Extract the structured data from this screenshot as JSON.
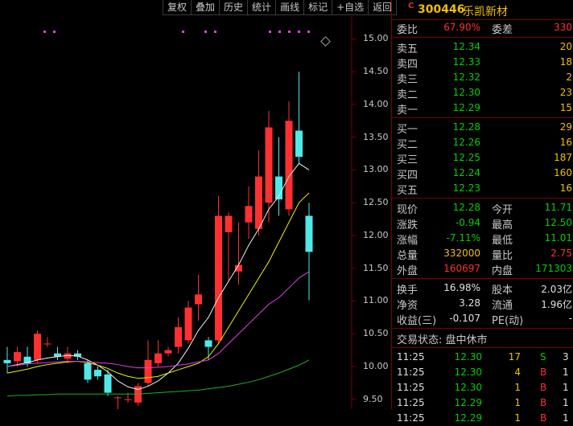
{
  "toolbar": [
    "复权",
    "叠加",
    "历史",
    "统计",
    "画线",
    "标记",
    "+自选",
    "返回"
  ],
  "stock": {
    "marker": "C",
    "code": "300446",
    "name": "乐凯新材"
  },
  "weibi": {
    "label": "委比",
    "value": "67.90%",
    "diff_label": "委差",
    "diff_value": "330"
  },
  "sell": [
    {
      "label": "卖五",
      "price": "12.34",
      "vol": "20"
    },
    {
      "label": "卖四",
      "price": "12.33",
      "vol": "18"
    },
    {
      "label": "卖三",
      "price": "12.32",
      "vol": "2"
    },
    {
      "label": "卖二",
      "price": "12.30",
      "vol": "23"
    },
    {
      "label": "卖一",
      "price": "12.29",
      "vol": "15"
    }
  ],
  "buy": [
    {
      "label": "买一",
      "price": "12.28",
      "vol": "29"
    },
    {
      "label": "买二",
      "price": "12.26",
      "vol": "16"
    },
    {
      "label": "买三",
      "price": "12.25",
      "vol": "187"
    },
    {
      "label": "买四",
      "price": "12.24",
      "vol": "160"
    },
    {
      "label": "买五",
      "price": "12.23",
      "vol": "16"
    }
  ],
  "quote": [
    {
      "l1": "现价",
      "v1": "12.28",
      "c1": "green",
      "l2": "今开",
      "v2": "11.71",
      "c2": "green"
    },
    {
      "l1": "涨跌",
      "v1": "-0.94",
      "c1": "green",
      "l2": "最高",
      "v2": "12.50",
      "c2": "green"
    },
    {
      "l1": "涨幅",
      "v1": "-7.11%",
      "c1": "green",
      "l2": "最低",
      "v2": "11.01",
      "c2": "green"
    },
    {
      "l1": "总量",
      "v1": "332000",
      "c1": "yellow",
      "l2": "量比",
      "v2": "2.75",
      "c2": "red"
    },
    {
      "l1": "外盘",
      "v1": "160697",
      "c1": "red",
      "l2": "内盘",
      "v2": "171303",
      "c2": "green"
    }
  ],
  "fund": [
    {
      "l1": "换手",
      "v1": "16.98%",
      "l2": "股本",
      "v2": "2.03亿"
    },
    {
      "l1": "净资",
      "v1": "3.28",
      "l2": "流通",
      "v2": "1.96亿"
    },
    {
      "l1": "收益(三)",
      "v1": "-0.107",
      "l2": "PE(动)",
      "v2": "-"
    }
  ],
  "trade_status": "交易状态: 盘中休市",
  "ticks": [
    {
      "time": "11:25",
      "price": "12.30",
      "vol": "17",
      "side": "S",
      "extra": "3"
    },
    {
      "time": "11:25",
      "price": "12.30",
      "vol": "4",
      "side": "B",
      "extra": "1"
    },
    {
      "time": "11:25",
      "price": "12.30",
      "vol": "1",
      "side": "B",
      "extra": "1"
    },
    {
      "time": "11:25",
      "price": "12.29",
      "vol": "1",
      "side": "B",
      "extra": "1"
    },
    {
      "time": "11:25",
      "price": "12.29",
      "vol": "1",
      "side": "B",
      "extra": "1"
    }
  ],
  "chart_data": {
    "type": "candlestick",
    "y_ticks": [
      "15.00",
      "14.50",
      "14.00",
      "13.50",
      "13.00",
      "12.50",
      "12.00",
      "11.50",
      "11.00",
      "10.50",
      "10.00",
      "9.50"
    ],
    "ylim": [
      9.35,
      15.25
    ],
    "candles": [
      {
        "o": 10.1,
        "c": 10.05,
        "h": 10.3,
        "l": 9.9
      },
      {
        "o": 10.08,
        "c": 10.22,
        "h": 10.3,
        "l": 10.0
      },
      {
        "o": 10.15,
        "c": 10.05,
        "h": 10.3,
        "l": 10.0
      },
      {
        "o": 10.1,
        "c": 10.5,
        "h": 10.55,
        "l": 10.05
      },
      {
        "o": 10.35,
        "c": 10.35,
        "h": 10.45,
        "l": 10.3
      },
      {
        "o": 10.2,
        "c": 10.15,
        "h": 10.3,
        "l": 10.1
      },
      {
        "o": 10.12,
        "c": 10.2,
        "h": 10.3,
        "l": 10.05
      },
      {
        "o": 10.2,
        "c": 10.15,
        "h": 10.25,
        "l": 10.1
      },
      {
        "o": 10.05,
        "c": 9.8,
        "h": 10.1,
        "l": 9.75
      },
      {
        "o": 9.95,
        "c": 9.85,
        "h": 10.0,
        "l": 9.8
      },
      {
        "o": 9.88,
        "c": 9.6,
        "h": 9.95,
        "l": 9.55
      },
      {
        "o": 9.53,
        "c": 9.53,
        "h": 9.55,
        "l": 9.22
      },
      {
        "o": 9.5,
        "c": 9.5,
        "h": 9.6,
        "l": 9.45
      },
      {
        "o": 9.45,
        "c": 9.7,
        "h": 9.75,
        "l": 9.4
      },
      {
        "o": 9.75,
        "c": 10.1,
        "h": 10.4,
        "l": 9.7
      },
      {
        "o": 10.05,
        "c": 10.2,
        "h": 10.4,
        "l": 10.0
      },
      {
        "o": 10.2,
        "c": 10.25,
        "h": 10.3,
        "l": 10.15
      },
      {
        "o": 10.3,
        "c": 10.6,
        "h": 10.75,
        "l": 10.2
      },
      {
        "o": 10.4,
        "c": 10.9,
        "h": 11.0,
        "l": 10.35
      },
      {
        "o": 10.95,
        "c": 11.1,
        "h": 11.4,
        "l": 10.7
      },
      {
        "o": 10.4,
        "c": 10.3,
        "h": 10.45,
        "l": 10.1
      },
      {
        "o": 10.4,
        "c": 12.3,
        "h": 12.6,
        "l": 10.35
      },
      {
        "o": 12.05,
        "c": 12.3,
        "h": 12.35,
        "l": 11.3
      },
      {
        "o": 11.45,
        "c": 11.55,
        "h": 12.2,
        "l": 11.25
      },
      {
        "o": 12.2,
        "c": 12.45,
        "h": 12.75,
        "l": 11.95
      },
      {
        "o": 12.1,
        "c": 12.9,
        "h": 13.3,
        "l": 12.0
      },
      {
        "o": 12.5,
        "c": 13.65,
        "h": 13.9,
        "l": 12.2
      },
      {
        "o": 12.9,
        "c": 12.55,
        "h": 13.5,
        "l": 12.3
      },
      {
        "o": 12.4,
        "c": 13.75,
        "h": 14.05,
        "l": 12.3
      },
      {
        "o": 13.6,
        "c": 13.2,
        "h": 14.5,
        "l": 13.1
      },
      {
        "o": 12.3,
        "c": 11.75,
        "h": 12.5,
        "l": 11.01
      }
    ],
    "ma_lines": [
      {
        "color": "#f0f0f0",
        "values": [
          10.0,
          10.03,
          10.06,
          10.1,
          10.13,
          10.15,
          10.17,
          10.16,
          10.1,
          10.02,
          9.92,
          9.78,
          9.69,
          9.65,
          9.7,
          9.78,
          9.9,
          10.05,
          10.28,
          10.55,
          10.75,
          11.05,
          11.3,
          11.55,
          11.85,
          12.1,
          12.4,
          12.6,
          12.9,
          13.1,
          13.0
        ]
      },
      {
        "color": "#f0f000",
        "values": [
          9.9,
          9.93,
          9.96,
          10.0,
          10.03,
          10.05,
          10.07,
          10.08,
          10.06,
          10.02,
          9.97,
          9.9,
          9.85,
          9.82,
          9.83,
          9.85,
          9.9,
          9.95,
          10.0,
          10.05,
          10.15,
          10.35,
          10.6,
          10.85,
          11.1,
          11.35,
          11.6,
          11.9,
          12.2,
          12.5,
          12.65
        ]
      },
      {
        "color": "#e040e0",
        "values": [
          10.0,
          10.02,
          10.04,
          10.05,
          10.06,
          10.07,
          10.08,
          10.08,
          10.07,
          10.06,
          10.05,
          10.03,
          10.0,
          9.98,
          9.98,
          9.99,
          10.0,
          10.02,
          10.04,
          10.07,
          10.1,
          10.2,
          10.35,
          10.5,
          10.65,
          10.8,
          10.95,
          11.05,
          11.2,
          11.35,
          11.45
        ]
      },
      {
        "color": "#20b020",
        "values": [
          9.55,
          9.56,
          9.56,
          9.57,
          9.57,
          9.58,
          9.58,
          9.58,
          9.58,
          9.58,
          9.58,
          9.58,
          9.58,
          9.58,
          9.59,
          9.6,
          9.61,
          9.62,
          9.63,
          9.64,
          9.66,
          9.68,
          9.7,
          9.73,
          9.76,
          9.8,
          9.85,
          9.9,
          9.96,
          10.02,
          10.1
        ]
      }
    ]
  }
}
